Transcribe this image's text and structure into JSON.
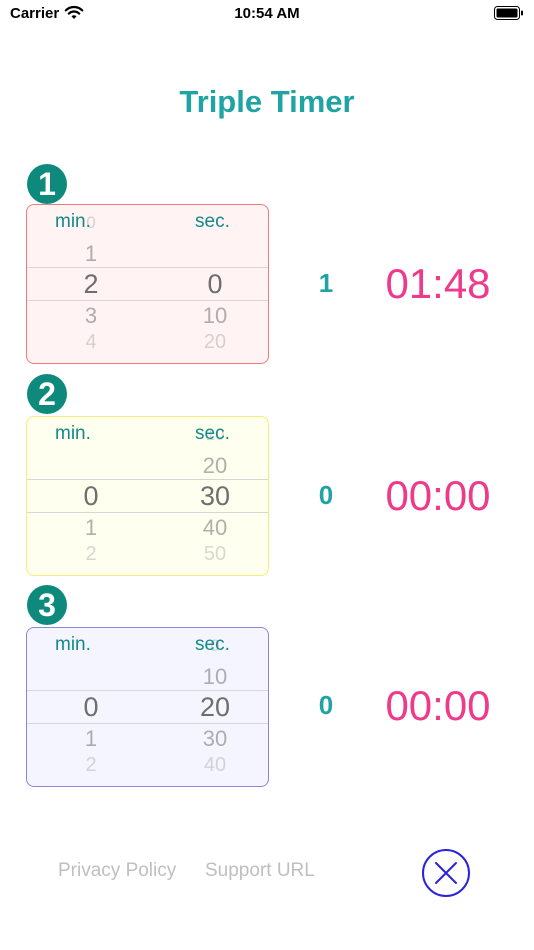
{
  "status": {
    "carrier": "Carrier",
    "time": "10:54 AM"
  },
  "app": {
    "title": "Triple Timer"
  },
  "timers": [
    {
      "badge": "1",
      "min_label": "min.",
      "sec_label": "sec.",
      "min_wheel": [
        "0",
        "1",
        "2",
        "3",
        "4"
      ],
      "sec_wheel": [
        "",
        "",
        "0",
        "10",
        "20"
      ],
      "count": "1",
      "time": "01:48",
      "tint": "#fff3f3",
      "border": "#f07a7a"
    },
    {
      "badge": "2",
      "min_label": "min.",
      "sec_label": "sec.",
      "min_wheel": [
        "",
        "",
        "0",
        "1",
        "2"
      ],
      "sec_wheel": [
        "10",
        "20",
        "30",
        "40",
        "50"
      ],
      "count": "0",
      "time": "00:00",
      "tint": "#fffff0",
      "border": "#f5ee7a"
    },
    {
      "badge": "3",
      "min_label": "min.",
      "sec_label": "sec.",
      "min_wheel": [
        "",
        "",
        "0",
        "1",
        "2"
      ],
      "sec_wheel": [
        "0",
        "10",
        "20",
        "30",
        "40"
      ],
      "count": "0",
      "time": "00:00",
      "tint": "#f5f5ff",
      "border": "#8a86de"
    }
  ],
  "footer": {
    "privacy": "Privacy Policy",
    "support": "Support URL"
  },
  "icons": {
    "close": "close-circle-icon",
    "wifi": "wifi-icon",
    "battery": "battery-icon"
  }
}
